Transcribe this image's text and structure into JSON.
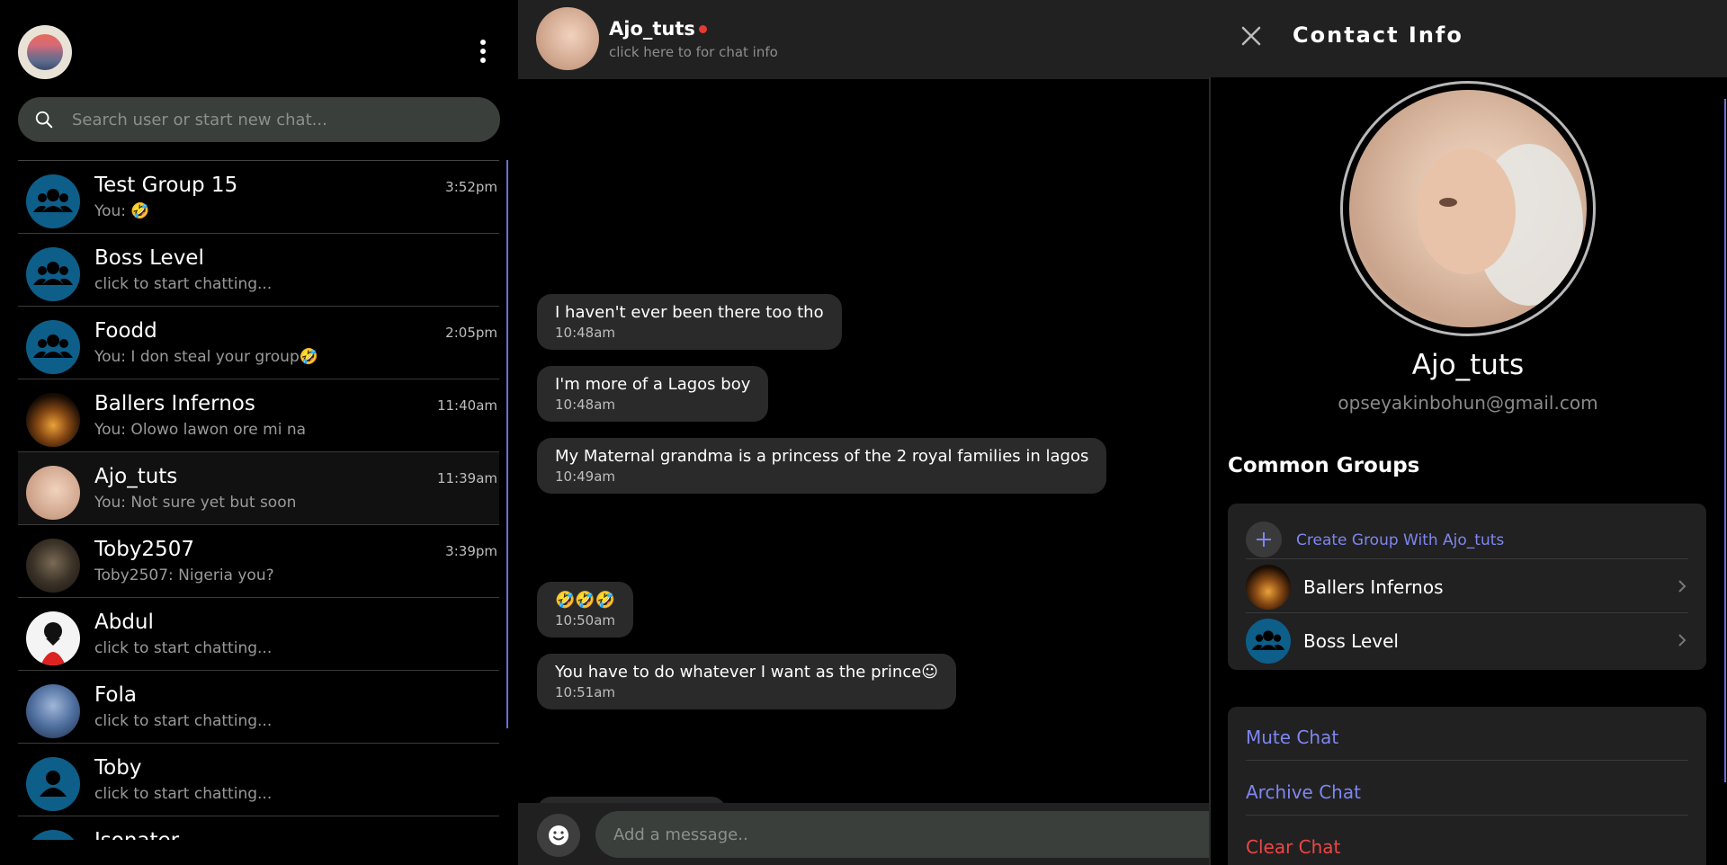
{
  "sidebar": {
    "search_placeholder": "Search user or start new chat...",
    "chats": [
      {
        "name": "Test Group 15",
        "preview": "You: 🤣",
        "time": "3:52pm",
        "avatar": "group-icon"
      },
      {
        "name": "Boss Level",
        "preview": "click to start chatting...",
        "time": "",
        "avatar": "group-icon"
      },
      {
        "name": "Foodd",
        "preview": "You: I don steal your group🤣",
        "time": "2:05pm",
        "avatar": "group-icon"
      },
      {
        "name": "Ballers Infernos",
        "preview": "You: Olowo lawon ore mi na",
        "time": "11:40am",
        "avatar": "photo"
      },
      {
        "name": "Ajo_tuts",
        "preview": "You: Not sure yet but soon",
        "time": "11:39am",
        "avatar": "photo"
      },
      {
        "name": "Toby2507",
        "preview": "Toby2507: Nigeria you?",
        "time": "3:39pm",
        "avatar": "photo"
      },
      {
        "name": "Abdul",
        "preview": "click to start chatting...",
        "time": "",
        "avatar": "photo"
      },
      {
        "name": "Fola",
        "preview": "click to start chatting...",
        "time": "",
        "avatar": "photo"
      },
      {
        "name": "Toby",
        "preview": "click to start chatting...",
        "time": "",
        "avatar": "person-icon"
      },
      {
        "name": "Isonater",
        "preview": "",
        "time": "",
        "avatar": "photo"
      }
    ]
  },
  "chat": {
    "contact_name": "Ajo_tuts",
    "subtitle": "click here to for chat info",
    "status_color": "#e53935",
    "messages": [
      {
        "text": "I haven't ever been there too tho",
        "time": "10:48am"
      },
      {
        "text": "I'm more of a Lagos boy",
        "time": "10:48am"
      },
      {
        "text": "My Maternal grandma is a princess of the 2 royal families in lagos",
        "time": "10:49am"
      },
      {
        "text": "🤣🤣🤣",
        "time": "10:50am"
      },
      {
        "text": "You have to do whatever I want as the prince☺",
        "time": "10:51am"
      }
    ],
    "input_placeholder": "Add a message.."
  },
  "info": {
    "title": "Contact Info",
    "name": "Ajo_tuts",
    "email": "opseyakinbohun@gmail.com",
    "common_groups_title": "Common Groups",
    "create_group_label": "Create Group With Ajo_tuts",
    "groups": [
      {
        "name": "Ballers Infernos"
      },
      {
        "name": "Boss Level"
      }
    ],
    "actions": {
      "mute": "Mute Chat",
      "archive": "Archive Chat",
      "clear": "Clear Chat"
    }
  },
  "colors": {
    "accent": "#7f86f0",
    "danger": "#f04545",
    "group_avatar": "#0d5f8a",
    "panel": "#212121"
  }
}
